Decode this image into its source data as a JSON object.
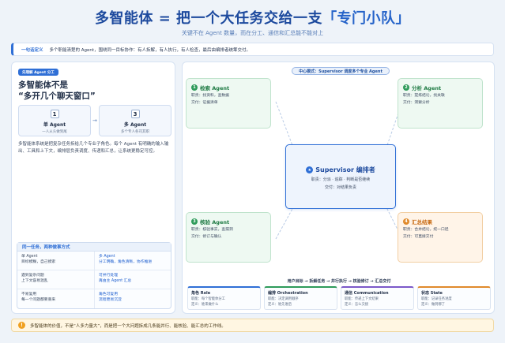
{
  "header": {
    "title_main": "多智能体 = 把一个大任务交给一支",
    "title_accent": "「专门小队」",
    "subtitle": "关键不在 Agent 数量，而在分工、通信和汇总能不能对上"
  },
  "banner": {
    "tag": "一句话定义",
    "text": "多个职能清楚的 Agent，围绕同一目标协作：有人拆解，有人执行，有人检查，最后由编排者统筹交付。"
  },
  "left": {
    "pill": "先理解 Agent 分工",
    "heading_line1": "多智能体不是",
    "heading_line2": "“多开几个聊天窗口”",
    "single": {
      "num": "1",
      "name": "单 Agent",
      "desc": "一人从头做到尾"
    },
    "multi": {
      "num": "3",
      "name": "多 Agent",
      "desc": "多个专人各司其职"
    },
    "arrow": "→",
    "description": "多智能体系统是把复杂任务拆给几个专业子角色。每个 Agent 有明确的输入输出、工具和上下文，编排层负责调度、传递和汇总，让系统更稳定可控。",
    "compare": {
      "title": "同一任务，两种做事方式",
      "rows": [
        {
          "left": "单 Agent\n目标模糊，自己摸索",
          "right": "多 Agent\n分工明确，角色清晰，协作推进"
        },
        {
          "left": "遇到复杂问题\n上下文容易混乱",
          "right": "可并行处理\n再由主 Agent 汇总"
        },
        {
          "left": "不易复用\n每一个问题都要重来",
          "right": "角色可复用\n流程更易沉淀"
        }
      ]
    }
  },
  "diagram": {
    "center_pill": "中心模式：Supervisor 调度多个专业 Agent",
    "search": {
      "num": "1",
      "title": "检索 Agent",
      "l1": "职责：找资料，查数据",
      "l2": "交付：证据清单"
    },
    "analysis": {
      "num": "2",
      "title": "分析 Agent",
      "l1": "职责：提炼结论，找关联",
      "l2": "交付：洞察分析"
    },
    "review": {
      "num": "3",
      "title": "核验 Agent",
      "l1": "职责：核验事实，查漏洞",
      "l2": "交付：修订与确认"
    },
    "summary": {
      "num": "4",
      "title": "汇总结果",
      "l1": "职责：合并结论，统一口径",
      "l2": "交付：可直接交付"
    },
    "supervisor": {
      "num": "★",
      "title": "Supervisor 编排者",
      "l1": "职责：分派 · 追踪 · 判断是否继续",
      "l2": "交付：对结果负责"
    },
    "flow": "用户目标 → 拆解任务 → 并行执行 → 核验修订 → 汇总交付",
    "cards": [
      {
        "title": "角色 Role",
        "l1": "职能：每个智能体分工",
        "l2": "定义：谁来做什么"
      },
      {
        "title": "编排 Orchestration",
        "l1": "职能：决定调用顺序",
        "l2": "定义：谁先谁后"
      },
      {
        "title": "通信 Communication",
        "l1": "职能：传递上下文结果",
        "l2": "定义：怎么交接"
      },
      {
        "title": "状态 State",
        "l1": "职能：记录任务进度",
        "l2": "定义：做到哪了"
      }
    ]
  },
  "footer": {
    "icon": "!",
    "text": "多智能体的价值，不是“人多力量大”，而是把一个大问题拆成几条能并行、能核验、能汇总的工作线。"
  },
  "colors": {
    "primary": "#2f6fd6",
    "green": "#2e9b5a",
    "orange": "#e08a2b",
    "purple": "#7b58c9"
  }
}
